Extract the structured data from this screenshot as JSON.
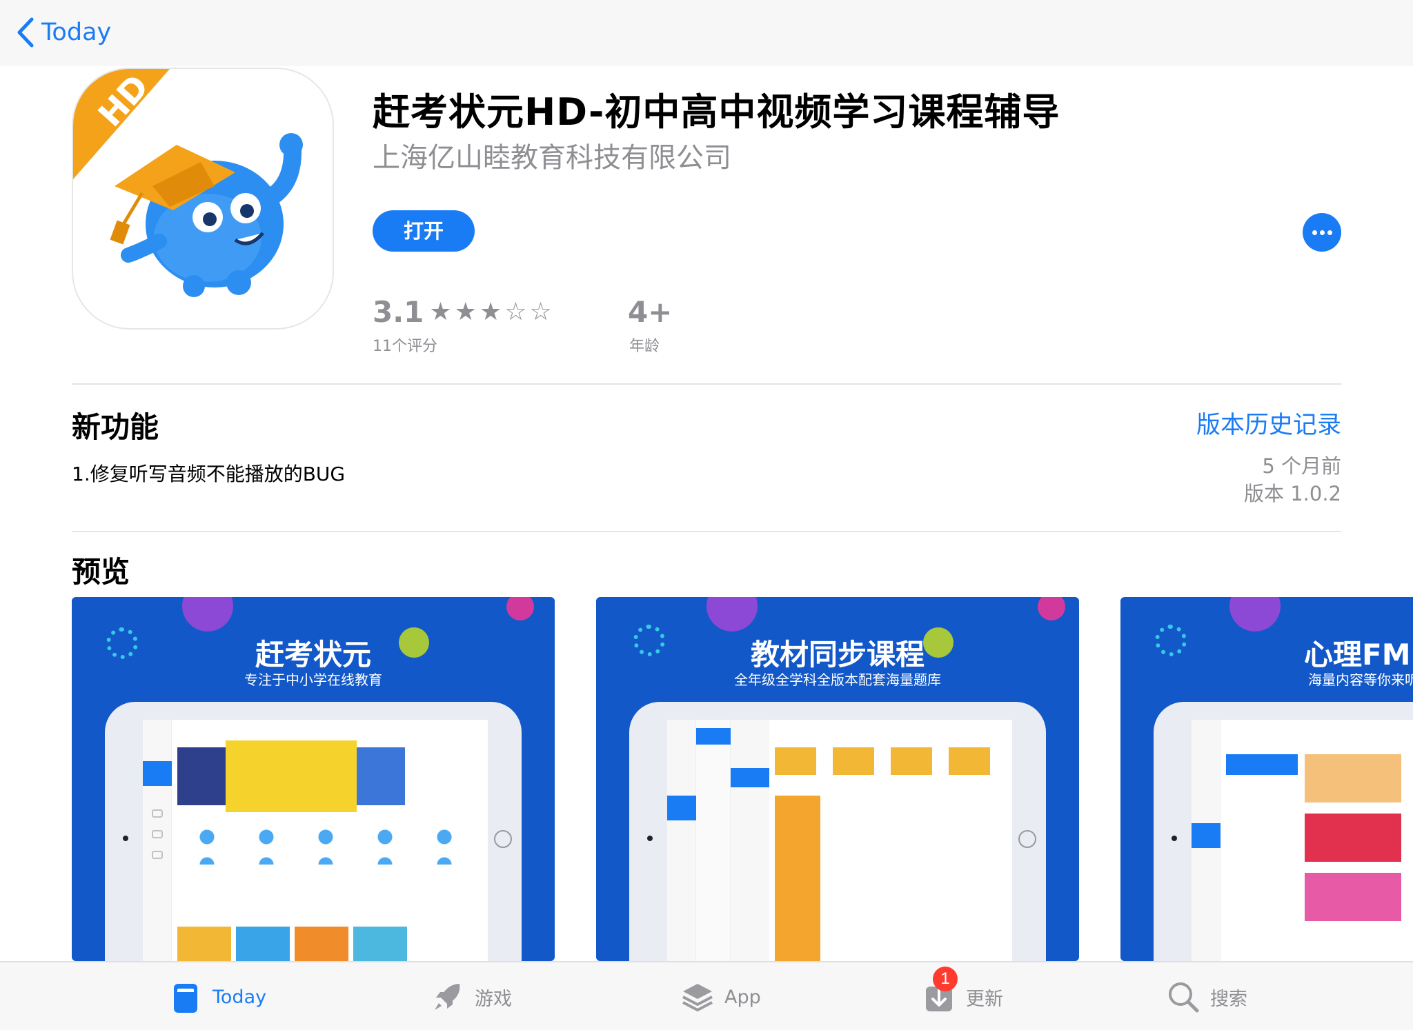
{
  "nav": {
    "back_label": "Today"
  },
  "app": {
    "title": "赶考状元HD-初中高中视频学习课程辅导",
    "developer": "上海亿山睦教育科技有限公司",
    "open_label": "打开",
    "icon_badge": "HD",
    "rating": {
      "score": "3.1",
      "stars": "★★★☆☆",
      "count_label": "11个评分"
    },
    "age": {
      "value": "4+",
      "label": "年龄"
    }
  },
  "whats_new": {
    "title": "新功能",
    "history_link": "版本历史记录",
    "notes": "1.修复听写音频不能播放的BUG",
    "time_ago": "5 个月前",
    "version": "版本 1.0.2"
  },
  "preview": {
    "title": "预览",
    "screenshots": [
      {
        "title": "赶考状元",
        "subtitle": "专注于中小学在线教育"
      },
      {
        "title": "教材同步课程",
        "subtitle": "全年级全学科全版本配套海量题库"
      },
      {
        "title": "心理FM",
        "subtitle": "海量内容等你来听"
      }
    ]
  },
  "tabbar": {
    "items": [
      {
        "label": "Today",
        "icon": "today-icon",
        "active": true
      },
      {
        "label": "游戏",
        "icon": "rocket-icon"
      },
      {
        "label": "App",
        "icon": "layers-icon"
      },
      {
        "label": "更新",
        "icon": "download-icon",
        "badge": "1"
      },
      {
        "label": "搜索",
        "icon": "search-icon"
      }
    ]
  },
  "colors": {
    "accent": "#1a7cf5",
    "badge": "#ff3b30",
    "shot_bg": "#1358c8",
    "secondary_text": "#8e8e93"
  }
}
